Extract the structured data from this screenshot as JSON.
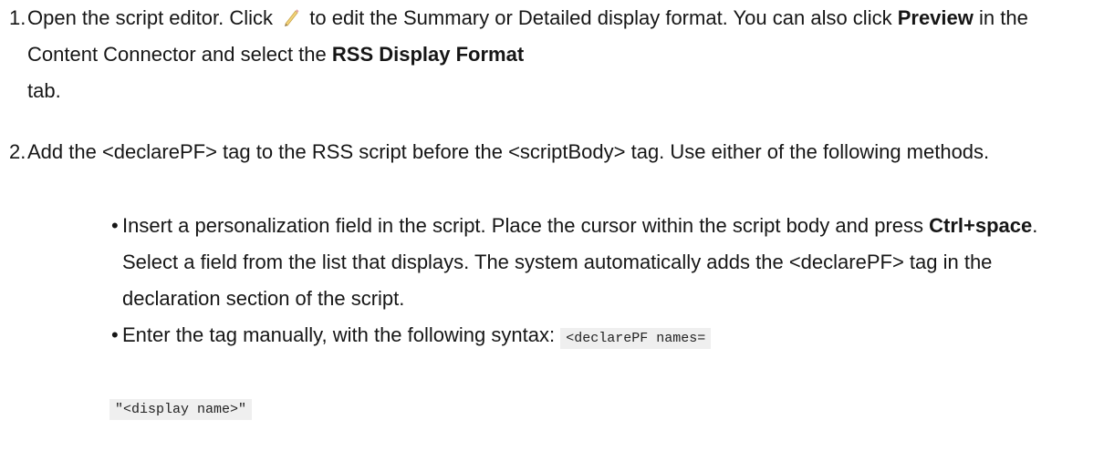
{
  "step1": {
    "number": "1.",
    "text_a": "Open the script editor. Click",
    "icon": "pencil-icon",
    "text_b": "to edit the Summary or Detailed display format. You can also click",
    "preview_bold": "Preview",
    "text_c": "in the Content Connector and select the",
    "rss_bold": "RSS Display Format",
    "text_d": "tab."
  },
  "step2": {
    "number": "2.",
    "text": "Add the <declarePF> tag to the RSS script before the <scriptBody> tag. Use either of the following methods."
  },
  "bullets": [
    {
      "dot": "•",
      "text_a": "Insert a personalization field in the script. Place the cursor within the script body and press",
      "bold": "Ctrl+space",
      "text_b": ". Select a field from the list that displays. The system automatically adds the <declarePF> tag in the declaration section of the script."
    },
    {
      "dot": "•",
      "text_a": "Enter the tag manually, with the following syntax:",
      "code_line1": "<declarePF names=",
      "code_line2": "\"<display name>\""
    }
  ]
}
